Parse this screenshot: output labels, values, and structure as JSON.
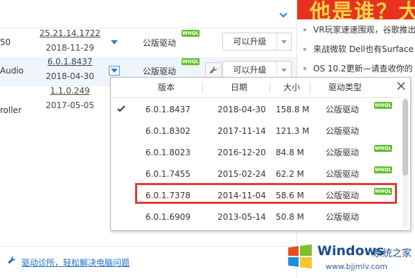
{
  "driver_rows": [
    {
      "name_fragment": "50",
      "version": "25.21.14.1722",
      "date": "2018-11-29",
      "type": "公版驱动",
      "whql": "WHQL",
      "action": "可以升级"
    },
    {
      "name_fragment": "Audio",
      "version": "6.0.1.8437",
      "date": "2018-04-30",
      "type": "公版驱动",
      "whql": "WHQL",
      "action": "可以升级"
    },
    {
      "name_fragment": "roller",
      "version": "1.1.0.249",
      "date": "2017-05-05"
    }
  ],
  "news": {
    "banner_text": "他是谁？大",
    "items": [
      "VR玩家速速围观，谷歌推出",
      "来战微软 Dell也有Surface",
      "OS 10.2更新—请查收你的"
    ]
  },
  "popup": {
    "headers": {
      "version": "版本",
      "date": "日期",
      "size": "大小",
      "type": "驱动类型"
    },
    "rows": [
      {
        "version": "6.0.1.8437",
        "date": "2018-04-30",
        "size": "158.8 M",
        "type": "公版驱动",
        "whql": "WHQL",
        "current": true
      },
      {
        "version": "6.0.1.8302",
        "date": "2017-11-14",
        "size": "121.3 M",
        "type": "公版驱动",
        "whql": ""
      },
      {
        "version": "6.0.1.8023",
        "date": "2016-12-20",
        "size": "84.8 M",
        "type": "公版驱动",
        "whql": "WHQL"
      },
      {
        "version": "6.0.1.7455",
        "date": "2015-02-24",
        "size": "62.2 M",
        "type": "公版驱动",
        "whql": "WHQL"
      },
      {
        "version": "6.0.1.7378",
        "date": "2014-11-04",
        "size": "58.6 M",
        "type": "公版驱动",
        "whql": "WHQL",
        "highlighted": true
      },
      {
        "version": "6.0.1.6909",
        "date": "2013-05-14",
        "size": "50.8 M",
        "type": "公版驱动",
        "whql": ""
      }
    ]
  },
  "footer": {
    "link_text": "驱动诊所，轻松解决电脑问题"
  },
  "watermark": {
    "title": "Windows",
    "subtitle": "系统之家",
    "url": "www.bjjmlv.com"
  },
  "colors": {
    "accent": "#2a7fd4",
    "highlight": "#e53935",
    "whql": "#5fbf2a",
    "banner": "#e8321f"
  }
}
